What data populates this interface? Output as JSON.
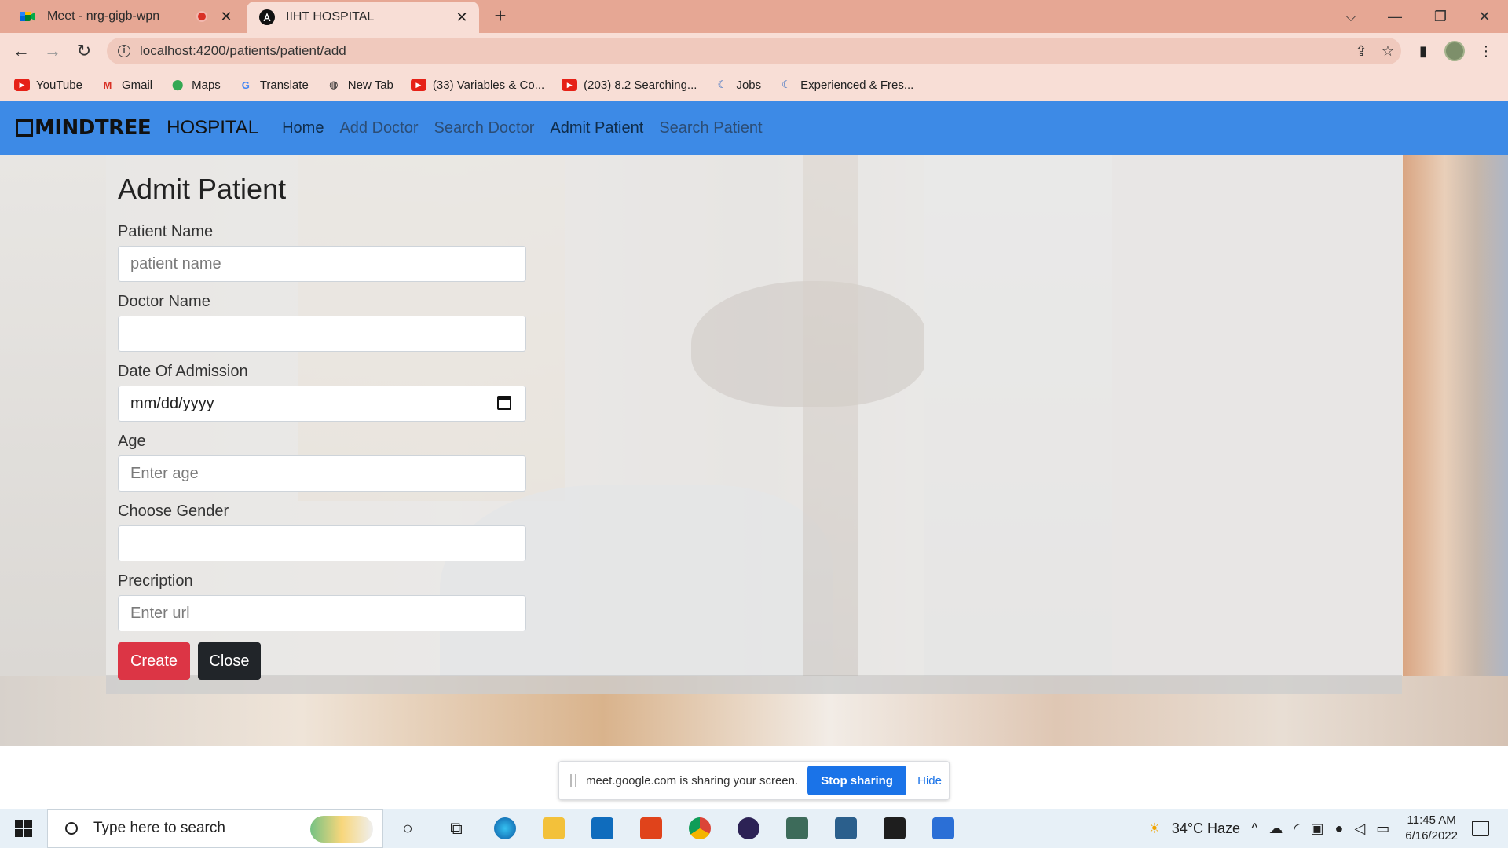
{
  "browser": {
    "tabs": [
      {
        "title": "Meet - nrg-gigb-wpn",
        "active": false
      },
      {
        "title": "IIHT HOSPITAL",
        "active": true
      }
    ],
    "url": "localhost:4200/patients/patient/add",
    "bookmarks": [
      "YouTube",
      "Gmail",
      "Maps",
      "Translate",
      "New Tab",
      "(33) Variables & Co...",
      "(203) 8.2 Searching...",
      "Jobs",
      "Experienced & Fres..."
    ]
  },
  "navbar": {
    "brand_logo": "MINDTREE",
    "brand_text": "HOSPITAL",
    "links": [
      "Home",
      "Add Doctor",
      "Search Doctor",
      "Admit Patient",
      "Search Patient"
    ]
  },
  "form": {
    "title": "Admit Patient",
    "fields": [
      {
        "label": "Patient Name",
        "placeholder": "patient name",
        "value": ""
      },
      {
        "label": "Doctor Name",
        "placeholder": "",
        "value": ""
      },
      {
        "label": "Date Of Admission",
        "placeholder": "mm/dd/yyyy",
        "value": ""
      },
      {
        "label": "Age",
        "placeholder": "Enter age",
        "value": ""
      },
      {
        "label": "Choose Gender",
        "placeholder": "",
        "value": ""
      },
      {
        "label": "Precription",
        "placeholder": "Enter url",
        "value": ""
      }
    ],
    "create_label": "Create",
    "close_label": "Close"
  },
  "share_bar": {
    "message": "meet.google.com is sharing your screen.",
    "stop_label": "Stop sharing",
    "hide_label": "Hide"
  },
  "taskbar": {
    "search_placeholder": "Type here to search",
    "weather": "34°C  Haze",
    "time": "11:45 AM",
    "date": "6/16/2022"
  },
  "colors": {
    "navbar": "#3d8ae6",
    "create_button": "#dc3545",
    "close_button": "#212529",
    "stop_sharing": "#1a73e8",
    "tabbar": "#e6a794"
  }
}
